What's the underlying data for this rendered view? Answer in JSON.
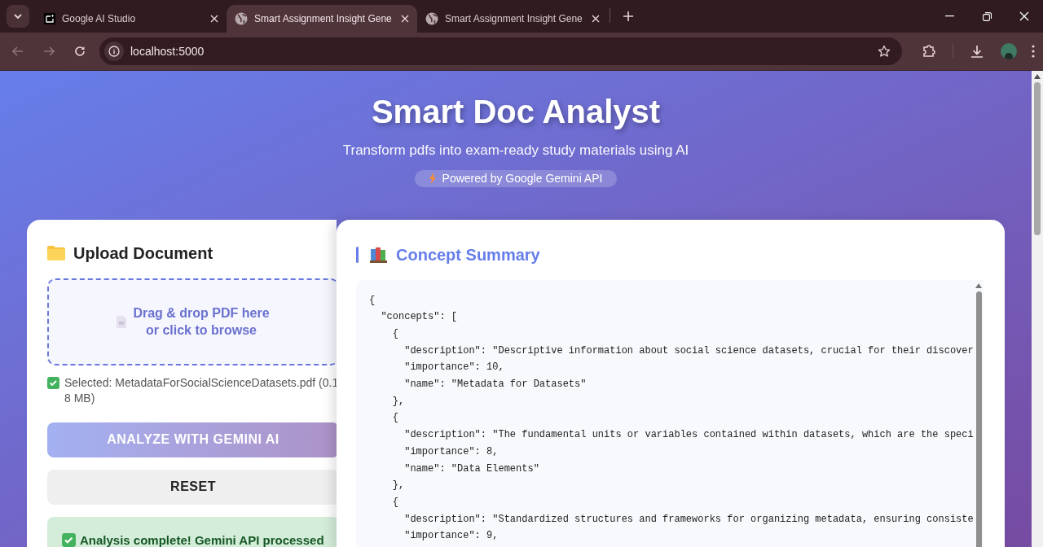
{
  "browser": {
    "tabs": [
      {
        "title": "Google AI Studio",
        "kind": "studio",
        "selected": false
      },
      {
        "title": "Smart Assignment Insight Gene",
        "kind": "web",
        "selected": true
      },
      {
        "title": "Smart Assignment Insight Gene",
        "kind": "web",
        "selected": false
      }
    ],
    "address": "localhost:5000"
  },
  "header": {
    "title": "Smart Doc Analyst",
    "subtitle": "Transform pdfs into exam-ready study materials using AI",
    "badge": "Powered by Google Gemini API"
  },
  "upload": {
    "title": "Upload Document",
    "dropzone": [
      "Drag & drop PDF here",
      "or click to browse"
    ],
    "selected_file": "Selected: MetadataForSocialScienceDatasets.pdf (0.18 MB)",
    "analyze_button": {
      "label": "ANALYZE WITH GEMINI AI",
      "disabled": true
    },
    "reset_button": {
      "label": "RESET",
      "disabled": false
    },
    "status": "Analysis complete! Gemini API processed"
  },
  "summary": {
    "title": "Concept Summary",
    "code_lines": [
      "{",
      "  \"concepts\": [",
      "    {",
      "      \"description\": \"Descriptive information about social science datasets, crucial for their discover",
      "      \"importance\": 10,",
      "      \"name\": \"Metadata for Datasets\"",
      "    },",
      "    {",
      "      \"description\": \"The fundamental units or variables contained within datasets, which are the speci",
      "      \"importance\": 8,",
      "      \"name\": \"Data Elements\"",
      "    },",
      "    {",
      "      \"description\": \"Standardized structures and frameworks for organizing metadata, ensuring consiste",
      "      \"importance\": 9,"
    ]
  }
}
